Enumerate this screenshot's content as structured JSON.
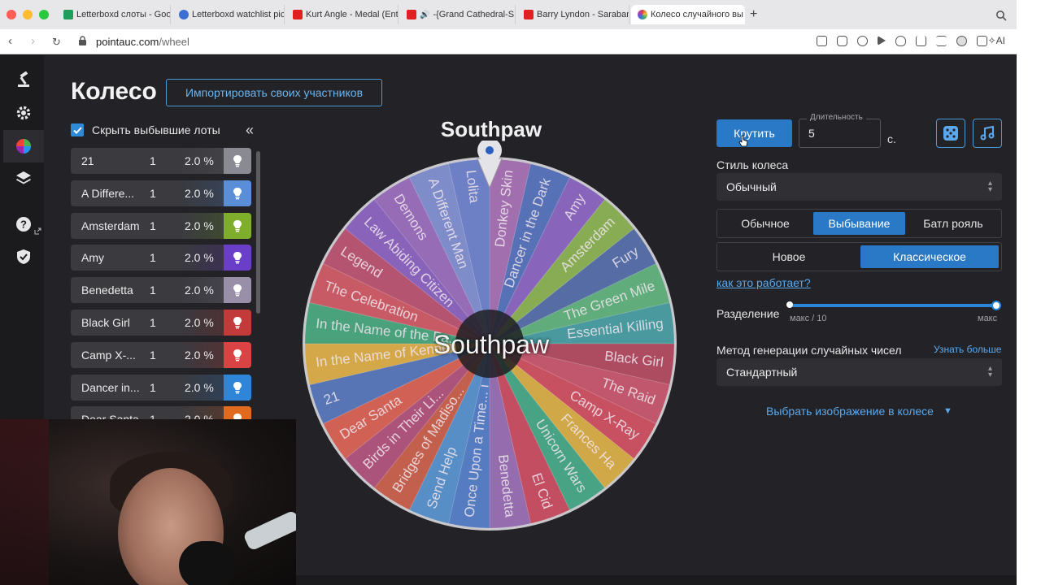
{
  "browser": {
    "tabs": [
      {
        "title": "Letterboxd слоты - Goo",
        "color": "#1e9e5a"
      },
      {
        "title": "Letterboxd watchlist pic",
        "color": "#3b6fd6"
      },
      {
        "title": "Kurt Angle - Medal (Entr",
        "color": "#e02020"
      },
      {
        "title": "-{Grand Cathedral-S",
        "color": "#e02020"
      },
      {
        "title": "Barry Lyndon - Saraband",
        "color": "#e02020"
      },
      {
        "title": "Колесо случайного вы",
        "color": "#7b4bd0"
      }
    ],
    "url_domain": "pointauc.com",
    "url_path": "/wheel",
    "ai_label": "AI"
  },
  "page": {
    "title": "Колесо",
    "import_button": "Импортировать своих участников",
    "hide_label": "Скрыть выбывшие лоты"
  },
  "lots": [
    {
      "name": "21",
      "amount": "1",
      "percent": "2.0 %",
      "color": "#8a8a92"
    },
    {
      "name": "A Differe...",
      "amount": "1",
      "percent": "2.0 %",
      "color": "#5a8fd8"
    },
    {
      "name": "Amsterdam",
      "amount": "1",
      "percent": "2.0 %",
      "color": "#7fae2c"
    },
    {
      "name": "Amy",
      "amount": "1",
      "percent": "2.0 %",
      "color": "#6a3ec6"
    },
    {
      "name": "Benedetta",
      "amount": "1",
      "percent": "2.0 %",
      "color": "#9a8fa8"
    },
    {
      "name": "Black Girl",
      "amount": "1",
      "percent": "2.0 %",
      "color": "#c23a3a"
    },
    {
      "name": "Camp X-...",
      "amount": "1",
      "percent": "2.0 %",
      "color": "#d94343"
    },
    {
      "name": "Dancer in...",
      "amount": "1",
      "percent": "2.0 %",
      "color": "#2f86d9"
    },
    {
      "name": "Dear Santa",
      "amount": "1",
      "percent": "2.0 %",
      "color": "#e06a1e"
    }
  ],
  "wheel": {
    "title": "Southpaw",
    "center_label": "Southpaw",
    "segments": [
      {
        "label": "Donkey Skin",
        "color": "#9a5ca8"
      },
      {
        "label": "Dancer in the Dark",
        "color": "#3e5fb0"
      },
      {
        "label": "Amy",
        "color": "#7b4fb8"
      },
      {
        "label": "Amsterdam",
        "color": "#7aa63a"
      },
      {
        "label": "Fury",
        "color": "#3d5a9c"
      },
      {
        "label": "The Green Mile",
        "color": "#4aa66a"
      },
      {
        "label": "Essential Killing",
        "color": "#2e8f95"
      },
      {
        "label": "Black Girl",
        "color": "#a8324a"
      },
      {
        "label": "The Raid",
        "color": "#bf3f57"
      },
      {
        "label": "Camp X-Ray",
        "color": "#c7364a"
      },
      {
        "label": "Frances Ha",
        "color": "#d4a12a"
      },
      {
        "label": "Unicorn Wars",
        "color": "#2b9b74"
      },
      {
        "label": "El Cid",
        "color": "#c2344a"
      },
      {
        "label": "Benedetta",
        "color": "#8a5aa8"
      },
      {
        "label": "Once Upon a Time... i",
        "color": "#3c6bbf"
      },
      {
        "label": "Send Help",
        "color": "#3e82c4"
      },
      {
        "label": "Bridges of Madiso...",
        "color": "#c34a32"
      },
      {
        "label": "Birds in Their Li...",
        "color": "#a73a6a"
      },
      {
        "label": "Dear Santa",
        "color": "#d24b3a"
      },
      {
        "label": "21",
        "color": "#3f63b0"
      },
      {
        "label": "In the Name of Kennel",
        "color": "#d7a02c"
      },
      {
        "label": "In the Name of the Fa...",
        "color": "#2f9a6c"
      },
      {
        "label": "The Celebration",
        "color": "#c9434f"
      },
      {
        "label": "Legend",
        "color": "#b23b5c"
      },
      {
        "label": "Law Abiding Citizen",
        "color": "#7c4db5"
      },
      {
        "label": "Demons",
        "color": "#8a58b0"
      },
      {
        "label": "A Different Man",
        "color": "#6f7fc9"
      },
      {
        "label": "Lolita",
        "color": "#5b71c4"
      }
    ]
  },
  "controls": {
    "spin_button": "Крутить",
    "duration_label": "Длительность",
    "duration_value": "5",
    "duration_unit": "с.",
    "style_label": "Стиль колеса",
    "style_value": "Обычный",
    "mode_options": [
      "Обычное",
      "Выбывание",
      "Батл рояль"
    ],
    "mode_selected": "Выбывание",
    "elim_options": [
      "Новое",
      "Классическое"
    ],
    "elim_selected": "Классическое",
    "how_link": "как это работает?",
    "split_label": "Разделение",
    "split_min": "макс / 10",
    "split_max": "макс",
    "split_fraction": 1.0,
    "rng_label": "Метод генерации случайных чисел",
    "learn_more": "Узнать больше",
    "rng_value": "Стандартный",
    "choose_image": "Выбрать изображение в колесе"
  },
  "colors": {
    "accent": "#2979c6",
    "link": "#5aa8ee",
    "background": "#232327"
  }
}
